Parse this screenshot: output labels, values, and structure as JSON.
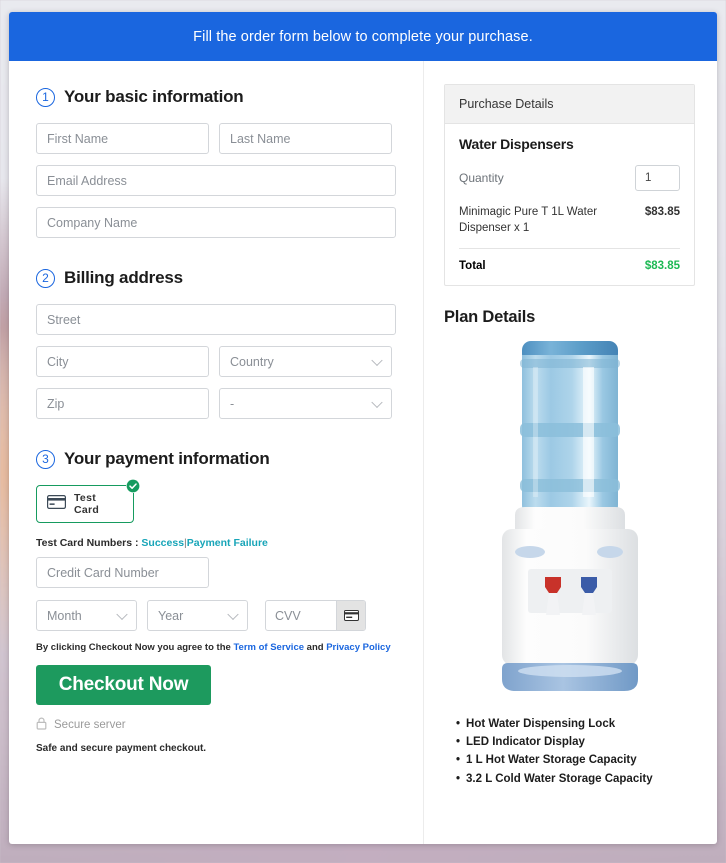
{
  "banner": {
    "text": "Fill the order form below to complete your purchase."
  },
  "sections": {
    "basic": {
      "number": "1",
      "title": "Your basic information",
      "fields": {
        "first_name": "First Name",
        "last_name": "Last Name",
        "email": "Email Address",
        "company": "Company Name"
      }
    },
    "billing": {
      "number": "2",
      "title": "Billing address",
      "fields": {
        "street": "Street",
        "city": "City",
        "country": "Country",
        "zip": "Zip",
        "state": "-"
      }
    },
    "payment": {
      "number": "3",
      "title": "Your payment information",
      "test_card_label": "Test  Card",
      "test_card_numbers_label": "Test Card Numbers :",
      "success_link": "Success",
      "separator": "|",
      "failure_link": "Payment Failure",
      "fields": {
        "credit_card": "Credit Card Number",
        "month": "Month",
        "year": "Year",
        "cvv": "CVV"
      },
      "terms_prefix": "By clicking Checkout Now you agree to the",
      "terms_link": "Term of Service",
      "terms_and": "and",
      "privacy_link": "Privacy Policy",
      "checkout_label": "Checkout Now",
      "secure_server": "Secure server",
      "safe_note": "Safe and secure payment checkout."
    }
  },
  "purchase": {
    "header": "Purchase Details",
    "product_title": "Water Dispensers",
    "quantity_label": "Quantity",
    "quantity_value": "1",
    "line_item": "Minimagic Pure T 1L Water Dispenser x 1",
    "line_price": "$83.85",
    "total_label": "Total",
    "total_value": "$83.85"
  },
  "plan": {
    "title": "Plan Details",
    "features": [
      "Hot Water Dispensing Lock",
      "LED Indicator Display",
      "1 L Hot Water Storage Capacity",
      "3.2 L Cold Water Storage Capacity"
    ]
  },
  "colors": {
    "banner_blue": "#1a66df",
    "accent_blue": "#1a66df",
    "checkout_green": "#1d9a5e",
    "total_green": "#1db954",
    "link_teal": "#18a5b8",
    "test_card_border": "#169b5f"
  }
}
